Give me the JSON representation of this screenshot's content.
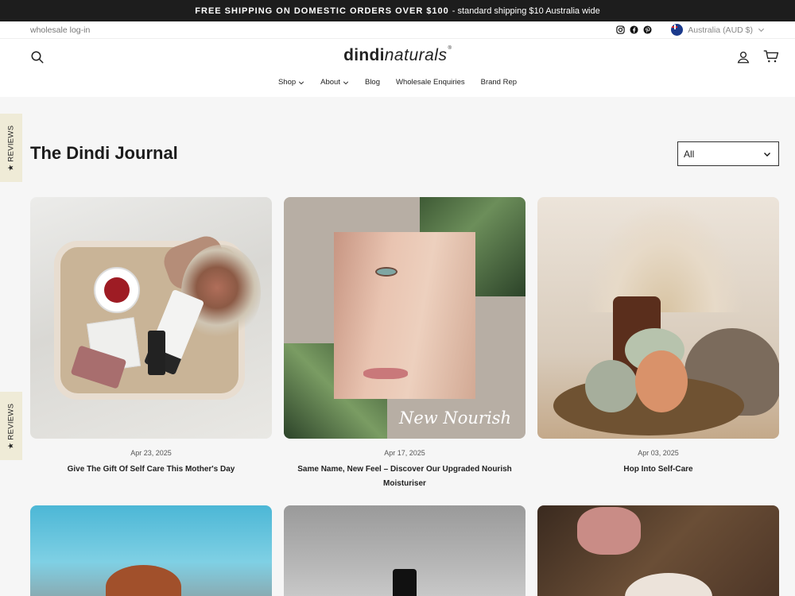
{
  "announcement": {
    "bold": "FREE SHIPPING ON DOMESTIC ORDERS OVER $100",
    "rest": "- standard shipping $10 Australia wide"
  },
  "topbar": {
    "wholesale_link": "wholesale log-in",
    "currency": "Australia (AUD $)"
  },
  "header": {
    "logo_bold": "dindi",
    "logo_italic": "naturals",
    "logo_mark": "®"
  },
  "nav": [
    {
      "label": "Shop",
      "has_dropdown": true
    },
    {
      "label": "About",
      "has_dropdown": true
    },
    {
      "label": "Blog",
      "has_dropdown": false
    },
    {
      "label": "Wholesale Enquiries",
      "has_dropdown": false
    },
    {
      "label": "Brand Rep",
      "has_dropdown": false
    }
  ],
  "reviews_tab": "★ REVIEWS",
  "page": {
    "title": "The Dindi Journal",
    "filter_selected": "All"
  },
  "articles": [
    {
      "date": "Apr 23, 2025",
      "title": "Give The Gift Of Self Care This Mother's Day"
    },
    {
      "date": "Apr 17, 2025",
      "title": "Same Name, New Feel – Discover Our Upgraded Nourish Moisturiser",
      "image_text": "New Nourish"
    },
    {
      "date": "Apr 03, 2025",
      "title": "Hop Into Self-Care"
    }
  ],
  "icons": {
    "search": "search-icon",
    "account": "account-icon",
    "cart": "cart-icon",
    "instagram": "instagram-icon",
    "facebook": "facebook-icon",
    "pinterest": "pinterest-icon"
  }
}
